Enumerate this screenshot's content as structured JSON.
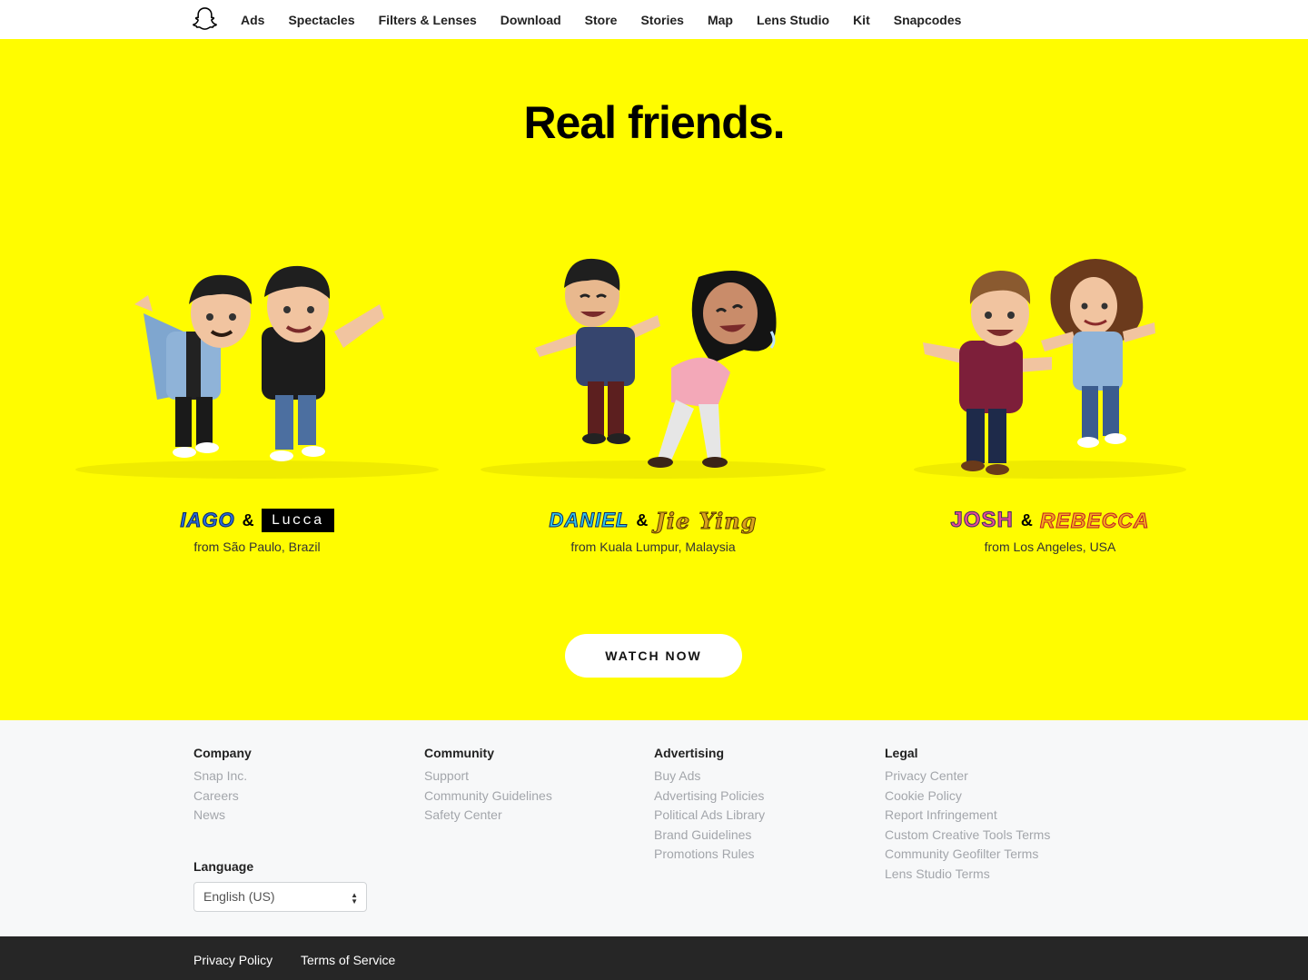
{
  "nav": {
    "logo": "snapchat-ghost-icon",
    "items": [
      "Ads",
      "Spectacles",
      "Filters & Lenses",
      "Download",
      "Store",
      "Stories",
      "Map",
      "Lens Studio",
      "Kit",
      "Snapcodes"
    ]
  },
  "hero": {
    "title": "Real friends.",
    "button": "WATCH NOW",
    "friends": [
      {
        "name1": "IAGO",
        "amp": "&",
        "name2": "Lucca",
        "origin": "from São Paulo, Brazil"
      },
      {
        "name1": "DANIEL",
        "amp": "&",
        "name2": "Jie Ying",
        "origin": "from Kuala Lumpur, Malaysia"
      },
      {
        "name1": "JOSH",
        "amp": "&",
        "name2": "REBECCA",
        "origin": "from Los Angeles, USA"
      }
    ]
  },
  "footer": {
    "columns": [
      {
        "title": "Company",
        "links": [
          "Snap Inc.",
          "Careers",
          "News"
        ]
      },
      {
        "title": "Community",
        "links": [
          "Support",
          "Community Guidelines",
          "Safety Center"
        ]
      },
      {
        "title": "Advertising",
        "links": [
          "Buy Ads",
          "Advertising Policies",
          "Political Ads Library",
          "Brand Guidelines",
          "Promotions Rules"
        ]
      },
      {
        "title": "Legal",
        "links": [
          "Privacy Center",
          "Cookie Policy",
          "Report Infringement",
          "Custom Creative Tools Terms",
          "Community Geofilter Terms",
          "Lens Studio Terms"
        ]
      }
    ],
    "language": {
      "title": "Language",
      "selected": "English (US)"
    }
  },
  "bottom": {
    "links": [
      "Privacy Policy",
      "Terms of Service"
    ]
  },
  "colors": {
    "brand_yellow": "#FFFC00",
    "bottom_bar": "#262626",
    "footer_bg": "#f7f8f9"
  }
}
